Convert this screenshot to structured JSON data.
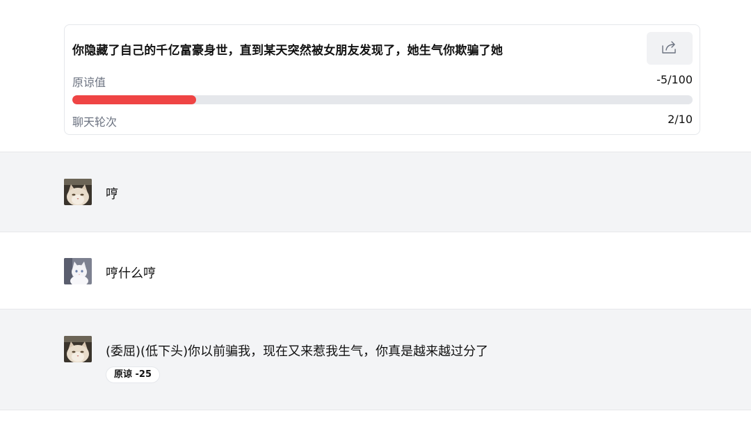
{
  "card": {
    "title": "你隐藏了自己的千亿富豪身世，直到某天突然被女朋友发现了，她生气你欺骗了她",
    "forgiveness_label": "原谅值",
    "forgiveness_value": "-5/100",
    "forgiveness_progress": 0.2,
    "rounds_label": "聊天轮次",
    "rounds_value": "2/10",
    "share_icon": "share-icon"
  },
  "messages": [
    {
      "role": "girlfriend",
      "avatar": "cat-avatar-tabby",
      "text": "哼"
    },
    {
      "role": "user",
      "avatar": "cat-avatar-white",
      "text": "哼什么哼"
    },
    {
      "role": "girlfriend",
      "avatar": "cat-avatar-tabby",
      "text": "(委屈)(低下头)你以前骗我，现在又来惹我生气，你真是越来越过分了",
      "badge": "原谅 -25"
    }
  ],
  "colors": {
    "progress_fill": "#ef4444",
    "progress_track": "#e5e7eb",
    "gray_row": "#f3f4f6"
  }
}
